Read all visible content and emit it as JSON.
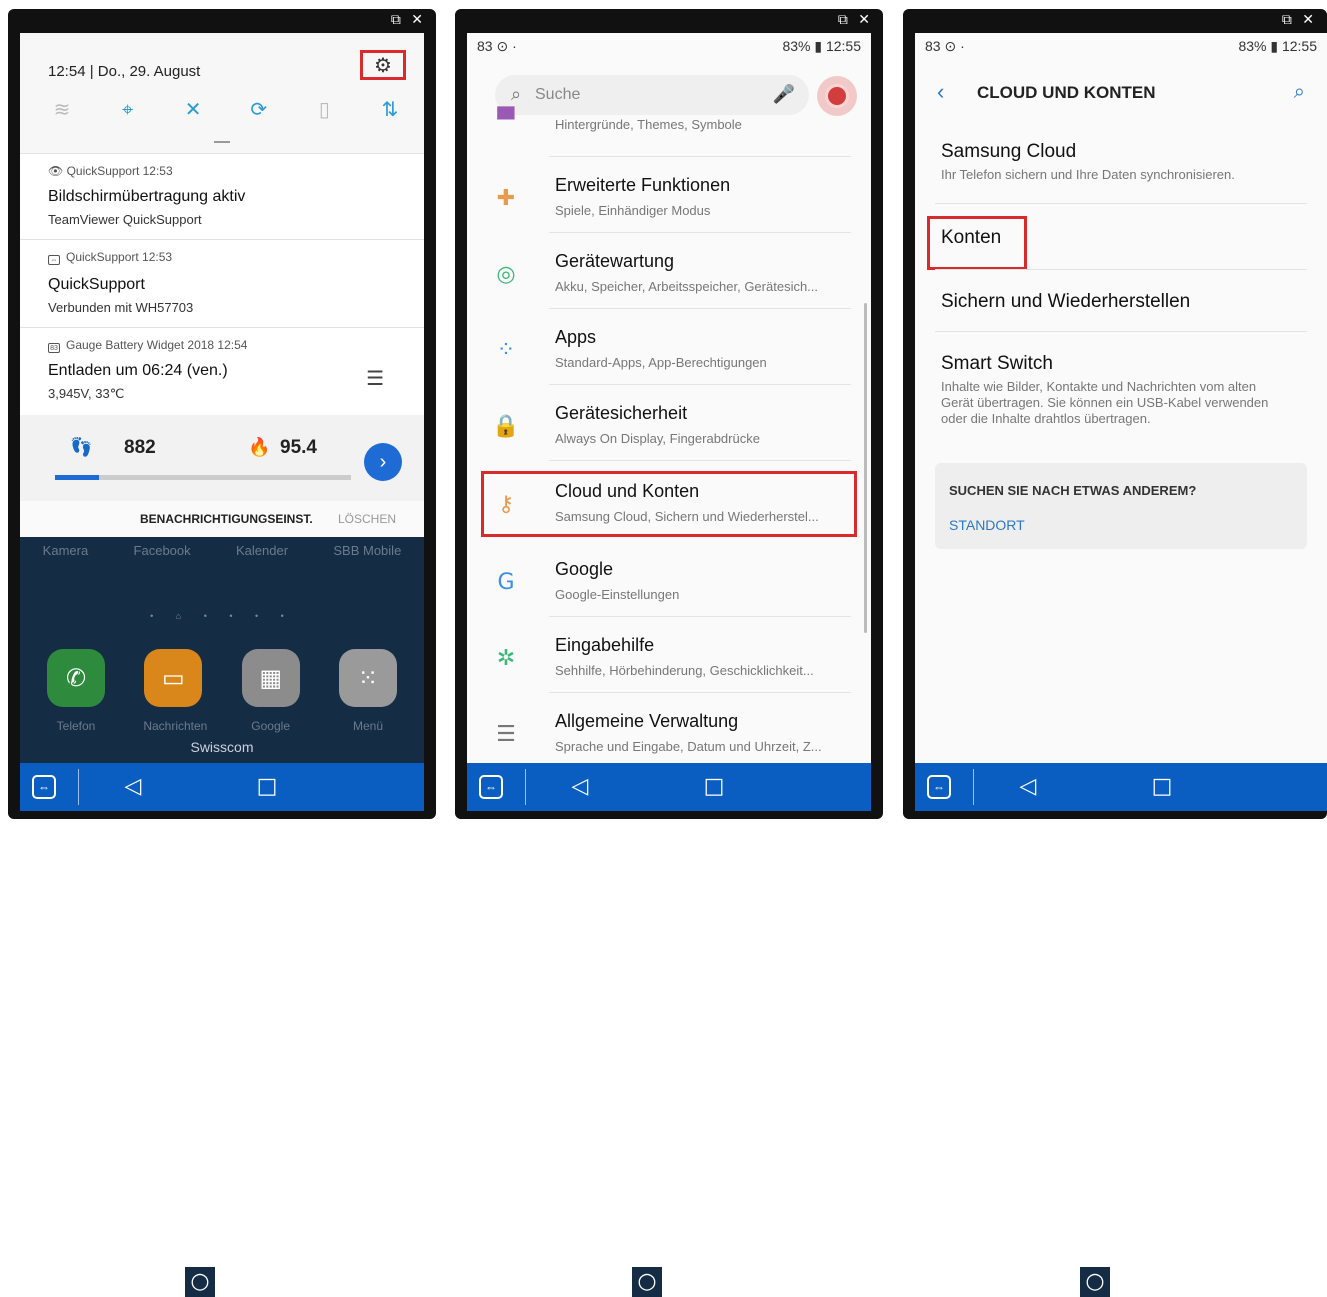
{
  "colors": {
    "accent_blue": "#0a5ec2",
    "highlight_red": "#d92b2b",
    "icon_orange": "#e89b4d",
    "link_blue": "#2b78c7"
  },
  "window_controls": "⧉ ✕",
  "nav_icons": [
    "teamviewer-icon",
    "back-icon",
    "home-icon",
    "recents-icon"
  ],
  "panel1": {
    "time_date": "12:54 | Do., 29. August",
    "quick_settings_icons": [
      "wifi-icon",
      "location-icon",
      "sound-off-icon",
      "rotation-icon",
      "document-icon",
      "data-transfer-icon"
    ],
    "notifications": [
      {
        "app": "QuickSupport  12:53",
        "title": "Bildschirmübertragung aktiv",
        "sub": "TeamViewer QuickSupport"
      },
      {
        "app": "QuickSupport  12:53",
        "title": "QuickSupport",
        "sub": "Verbunden mit WH57703"
      },
      {
        "app": "Gauge Battery Widget 2018  12:54",
        "badge": "83",
        "title": "Entladen um 06:24 (ven.)",
        "sub": "3,945V, 33℃"
      }
    ],
    "widget": {
      "steps": "882",
      "calories": "95.4",
      "progress": 0.15
    },
    "actions": {
      "settings": "BENACHRICHTIGUNGSEINST.",
      "clear": "LÖSCHEN"
    },
    "home_labels": [
      "Kamera",
      "Facebook",
      "Kalender",
      "SBB Mobile"
    ],
    "dock": [
      {
        "label": "Telefon",
        "icon": "phone-icon",
        "color": "#2e8b3d"
      },
      {
        "label": "Nachrichten",
        "icon": "messages-icon",
        "color": "#d9861b"
      },
      {
        "label": "Google",
        "icon": "google-folder-icon",
        "color": "#8c8c8c"
      },
      {
        "label": "Menü",
        "icon": "apps-icon",
        "color": "#9a9a9a"
      }
    ],
    "carrier": "Swisscom"
  },
  "panel2": {
    "status_left": "83 ⊙ ·",
    "status_right": "83% ▮ 12:55",
    "search_placeholder": "Suche",
    "items": [
      {
        "title": "",
        "sub": "Hintergründe, Themes, Symbole",
        "icon": "themes-icon"
      },
      {
        "title": "Erweiterte Funktionen",
        "sub": "Spiele, Einhändiger Modus",
        "icon": "advanced-features-icon"
      },
      {
        "title": "Gerätewartung",
        "sub": "Akku, Speicher, Arbeitsspeicher, Gerätesich...",
        "icon": "device-maintenance-icon"
      },
      {
        "title": "Apps",
        "sub": "Standard-Apps, App-Berechtigungen",
        "icon": "apps-icon"
      },
      {
        "title": "Gerätesicherheit",
        "sub": "Always On Display, Fingerabdrücke",
        "icon": "lock-icon"
      },
      {
        "title": "Cloud und Konten",
        "sub": "Samsung Cloud, Sichern und Wiederherstel...",
        "icon": "key-icon"
      },
      {
        "title": "Google",
        "sub": "Google-Einstellungen",
        "icon": "google-icon"
      },
      {
        "title": "Eingabehilfe",
        "sub": "Sehhilfe, Hörbehinderung, Geschicklichkeit...",
        "icon": "accessibility-icon"
      },
      {
        "title": "Allgemeine Verwaltung",
        "sub": "Sprache und Eingabe, Datum und Uhrzeit, Z...",
        "icon": "sliders-icon"
      }
    ]
  },
  "panel3": {
    "status_left": "83 ⊙ ·",
    "status_right": "83% ▮ 12:55",
    "title": "CLOUD UND KONTEN",
    "items": [
      {
        "title": "Samsung Cloud",
        "sub": "Ihr Telefon sichern und Ihre Daten synchronisieren."
      },
      {
        "title": "Konten",
        "sub": ""
      },
      {
        "title": "Sichern und Wiederherstellen",
        "sub": ""
      },
      {
        "title": "Smart Switch",
        "sub": "Inhalte wie Bilder, Kontakte und Nachrichten vom alten Gerät übertragen. Sie können ein USB-Kabel verwenden oder die Inhalte drahtlos übertragen."
      }
    ],
    "card": {
      "question": "SUCHEN SIE NACH ETWAS ANDEREM?",
      "link": "STANDORT"
    }
  }
}
